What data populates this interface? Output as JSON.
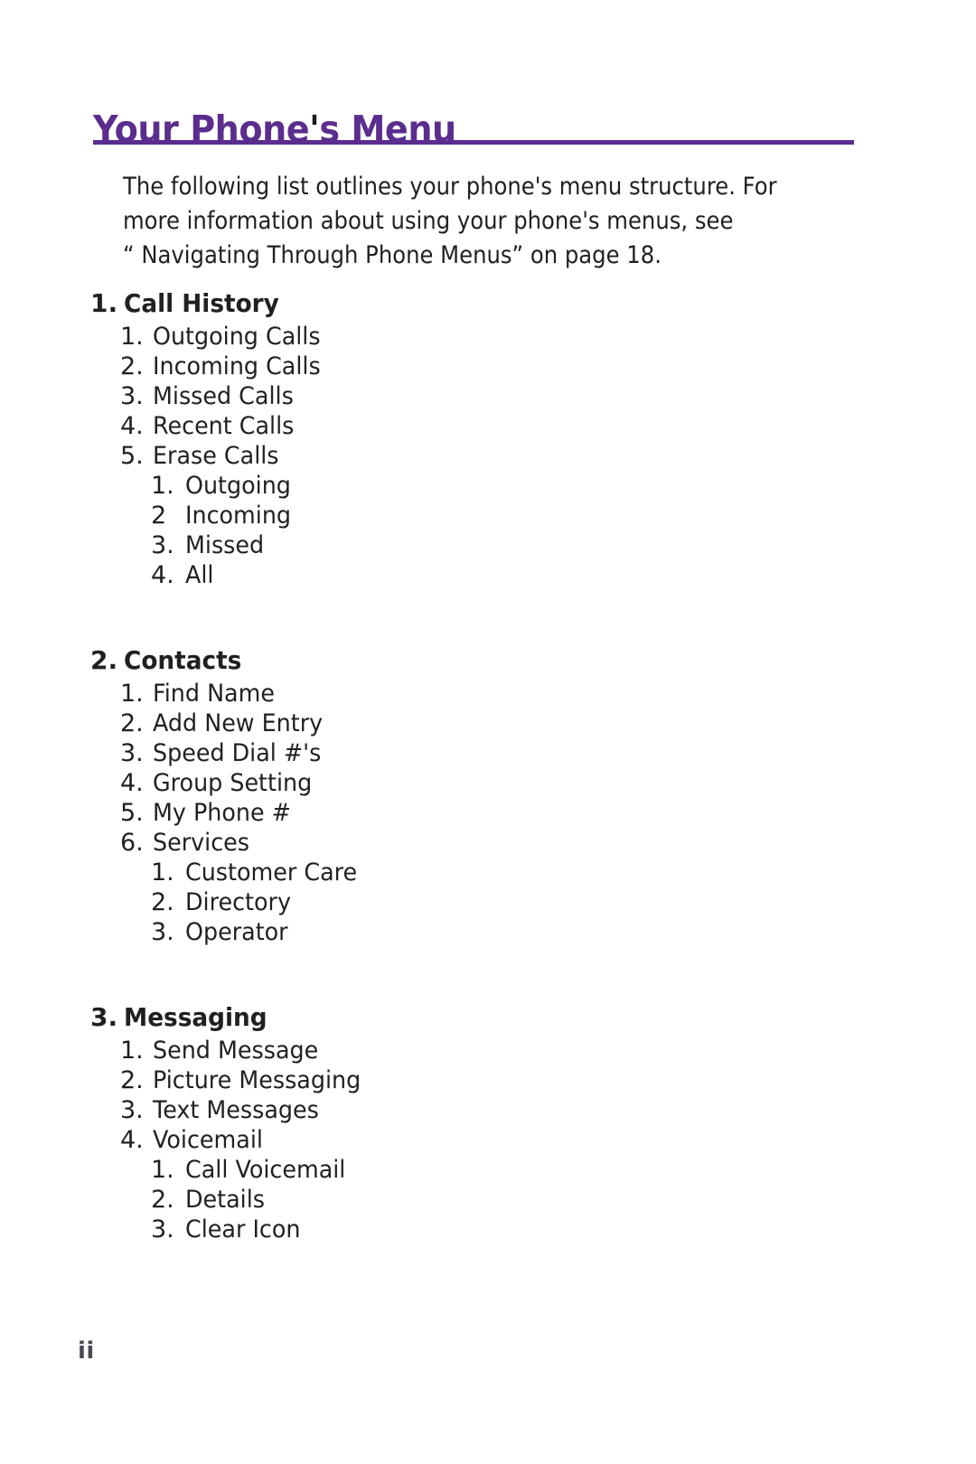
{
  "document": {
    "title": "Your Phone's Menu",
    "title_color": "#5B2D8E",
    "rule_color": "#5B2D8E",
    "body_color": "#231f20",
    "folio": "ii"
  },
  "intro": {
    "line1": "The following list outlines your phone's menu structure. For",
    "line2": "more information about using your phone's menus, see",
    "line3": "“ Navigating Through Phone Menus” on page 18."
  },
  "outline": {
    "sections": [
      {
        "num": "1.",
        "label": "Call History",
        "items": [
          {
            "num": "1.",
            "label": "Outgoing Calls"
          },
          {
            "num": "2.",
            "label": "Incoming Calls"
          },
          {
            "num": "3.",
            "label": "Missed Calls"
          },
          {
            "num": "4.",
            "label": "Recent Calls"
          },
          {
            "num": "5.",
            "label": "Erase Calls",
            "children": [
              {
                "num": "1.",
                "label": "Outgoing"
              },
              {
                "num": "2",
                "label": "Incoming"
              },
              {
                "num": "3.",
                "label": "Missed"
              },
              {
                "num": "4.",
                "label": "All"
              }
            ]
          }
        ]
      },
      {
        "num": "2.",
        "label": "Contacts",
        "items": [
          {
            "num": "1.",
            "label": "Find Name"
          },
          {
            "num": "2.",
            "label": "Add New Entry"
          },
          {
            "num": "3.",
            "label": "Speed Dial #'s"
          },
          {
            "num": "4.",
            "label": "Group Setting"
          },
          {
            "num": "5.",
            "label": "My Phone #"
          },
          {
            "num": "6.",
            "label": "Services",
            "children": [
              {
                "num": "1.",
                "label": "Customer Care"
              },
              {
                "num": "2.",
                "label": "Directory"
              },
              {
                "num": "3.",
                "label": "Operator"
              }
            ]
          }
        ]
      },
      {
        "num": "3.",
        "label": "Messaging",
        "items": [
          {
            "num": "1.",
            "label": "Send Message"
          },
          {
            "num": "2.",
            "label": "Picture Messaging"
          },
          {
            "num": "3.",
            "label": "Text Messages"
          },
          {
            "num": "4.",
            "label": "Voicemail",
            "children": [
              {
                "num": "1.",
                "label": "Call Voicemail"
              },
              {
                "num": "2.",
                "label": "Details"
              },
              {
                "num": "3.",
                "label": "Clear Icon"
              }
            ]
          }
        ]
      }
    ]
  }
}
